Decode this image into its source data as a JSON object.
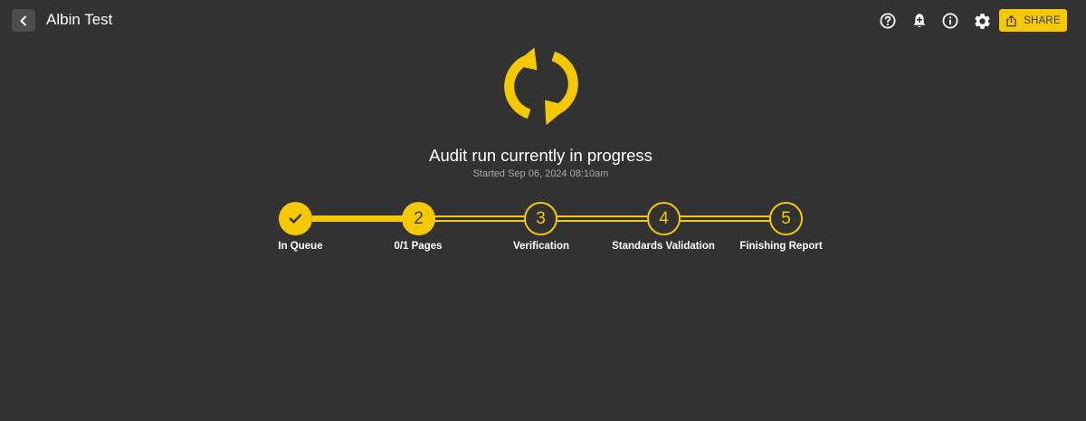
{
  "header": {
    "title": "Albin Test",
    "back_icon": "chevron-left-icon",
    "icons": [
      "help-circle-icon",
      "bell-plus-icon",
      "info-icon",
      "gear-icon"
    ],
    "share_label": "SHARE",
    "share_icon": "share-upload-icon"
  },
  "status": {
    "icon": "sync-arrows-icon",
    "title": "Audit run currently in progress",
    "subtitle": "Started Sep 06, 2024 08:10am"
  },
  "stepper": {
    "steps": [
      {
        "number": "",
        "label": "In Queue",
        "state": "done",
        "icon": "check-icon"
      },
      {
        "number": "2",
        "label": "0/1 Pages",
        "state": "active"
      },
      {
        "number": "3",
        "label": "Verification",
        "state": "pending"
      },
      {
        "number": "4",
        "label": "Standards Validation",
        "state": "pending"
      },
      {
        "number": "5",
        "label": "Finishing Report",
        "state": "pending"
      }
    ]
  },
  "colors": {
    "background": "#323232",
    "accent": "#f5c900",
    "text": "#ffffff",
    "muted": "#a8a8a8"
  }
}
